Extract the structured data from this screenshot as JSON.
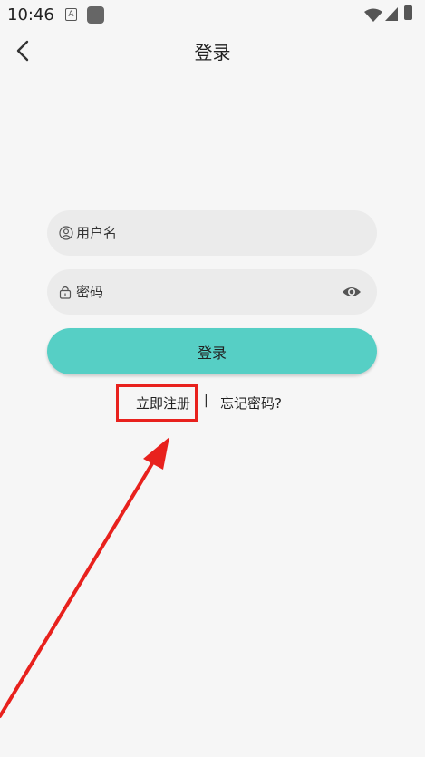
{
  "status_bar": {
    "time": "10:46",
    "a_glyph": "A",
    "icons": [
      "a-notification-icon",
      "app-notification-icon",
      "wifi-icon",
      "signal-icon",
      "battery-icon"
    ]
  },
  "app_bar": {
    "title": "登录",
    "back_icon": "chevron-left-icon"
  },
  "form": {
    "username_placeholder": "用户名",
    "password_placeholder": "密码",
    "login_label": "登录",
    "username_icon": "user-icon",
    "password_icon": "lock-icon",
    "visibility_icon": "eye-icon"
  },
  "links": {
    "register": "立即注册",
    "divider": "|",
    "forgot": "忘记密码?"
  },
  "colors": {
    "background": "#f6f6f6",
    "field": "#ebebeb",
    "accent": "#56cfc5",
    "annotation": "#e8211d"
  }
}
